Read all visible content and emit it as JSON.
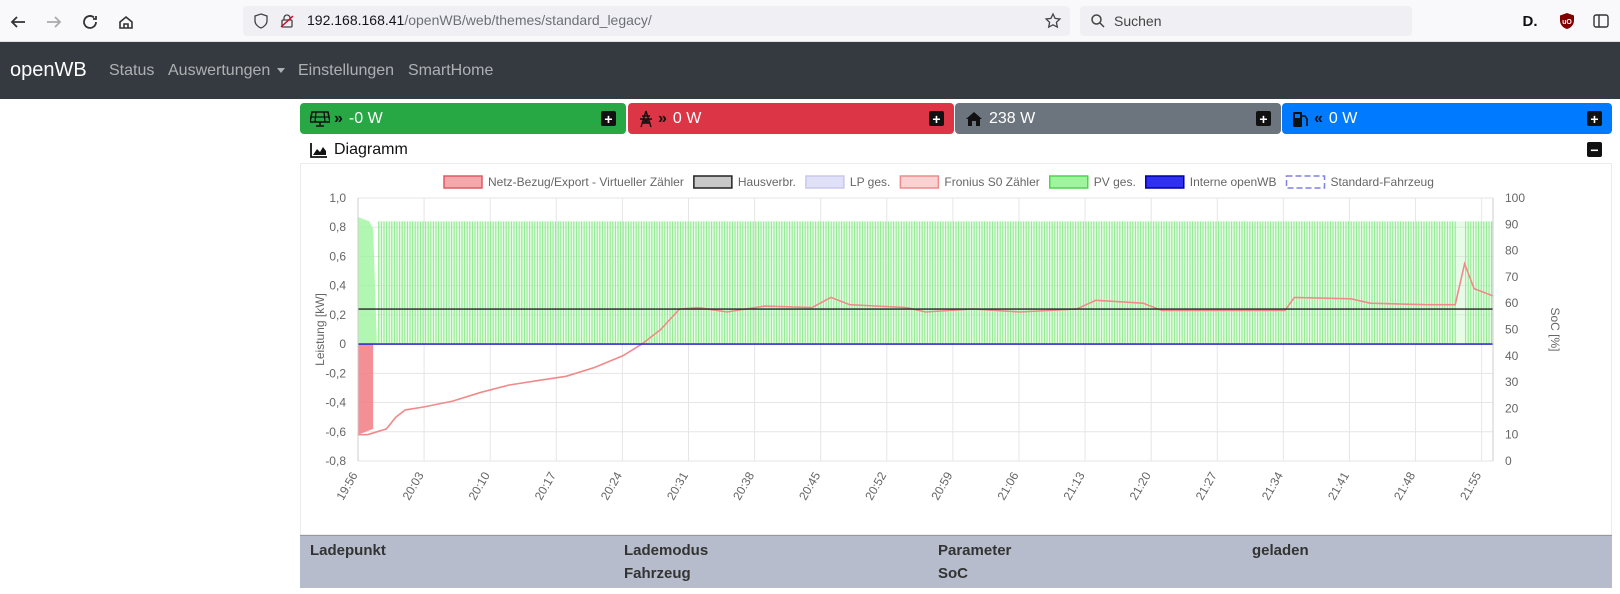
{
  "browser": {
    "url_host": "192.168.168.41",
    "url_path": "/openWB/web/themes/standard_legacy/",
    "search_placeholder": "Suchen"
  },
  "navbar": {
    "brand": "openWB",
    "items": [
      {
        "label": "Status"
      },
      {
        "label": "Auswertungen"
      },
      {
        "label": "Einstellungen"
      },
      {
        "label": "SmartHome"
      }
    ]
  },
  "tiles": {
    "pv": {
      "value": "-0 W",
      "color": "#28a745"
    },
    "grid": {
      "value": "0 W",
      "color": "#dc3545"
    },
    "house": {
      "value": "238 W",
      "color": "#6c757d"
    },
    "battery": {
      "value": "0 W",
      "color": "#007bff"
    }
  },
  "diagram": {
    "title": "Diagramm"
  },
  "chart_data": {
    "type": "line",
    "legend": [
      {
        "name": "Netz-Bezug/Export - Virtueller Zähler",
        "color": "#f4a8ac",
        "border": "#e05a63"
      },
      {
        "name": "Hausverbr.",
        "color": "#c8c8c8",
        "border": "#222222"
      },
      {
        "name": "LP ges.",
        "color": "#e0e0f7",
        "border": "#c8c8ee"
      },
      {
        "name": "Fronius S0 Zähler",
        "color": "#fbd2d2",
        "border": "#f08a8a"
      },
      {
        "name": "PV ges.",
        "color": "#9ef59e",
        "border": "#4cd64c"
      },
      {
        "name": "Interne openWB",
        "color": "#3030f0",
        "border": "#0000a0"
      },
      {
        "name": "Standard-Fahrzeug",
        "color": "#ffffff",
        "border": "#8080e0",
        "dashed": true
      }
    ],
    "legend_position": "top",
    "ylabel": "Leistung [kW]",
    "y2label": "SoC [%]",
    "ylim": [
      -0.8,
      1.0
    ],
    "y2lim": [
      0,
      100
    ],
    "yticks": [
      "1,0",
      "0,8",
      "0,6",
      "0,4",
      "0,2",
      "0",
      "-0,2",
      "-0,4",
      "-0,6",
      "-0,8"
    ],
    "y2ticks": [
      "100",
      "90",
      "80",
      "70",
      "60",
      "50",
      "40",
      "30",
      "20",
      "10",
      "0"
    ],
    "xticks": [
      "19:56",
      "20:03",
      "20:10",
      "20:17",
      "20:24",
      "20:31",
      "20:38",
      "20:45",
      "20:52",
      "20:59",
      "21:06",
      "21:13",
      "21:20",
      "21:27",
      "21:34",
      "21:41",
      "21:48",
      "21:55"
    ],
    "x_minutes_range": [
      0,
      120
    ],
    "hausverbr_kw": 0.24,
    "pv_peak_kw": 0.84,
    "grid_series": [
      {
        "t": 0,
        "kw": -0.62
      },
      {
        "t": 1,
        "kw": -0.62
      },
      {
        "t": 2,
        "kw": -0.6
      },
      {
        "t": 3,
        "kw": -0.58
      },
      {
        "t": 4,
        "kw": -0.5
      },
      {
        "t": 5,
        "kw": -0.45
      },
      {
        "t": 7,
        "kw": -0.43
      },
      {
        "t": 10,
        "kw": -0.39
      },
      {
        "t": 13,
        "kw": -0.33
      },
      {
        "t": 16,
        "kw": -0.28
      },
      {
        "t": 19,
        "kw": -0.25
      },
      {
        "t": 22,
        "kw": -0.22
      },
      {
        "t": 25,
        "kw": -0.16
      },
      {
        "t": 28,
        "kw": -0.08
      },
      {
        "t": 30,
        "kw": 0.0
      },
      {
        "t": 32,
        "kw": 0.1
      },
      {
        "t": 34,
        "kw": 0.24
      },
      {
        "t": 36,
        "kw": 0.25
      },
      {
        "t": 39,
        "kw": 0.22
      },
      {
        "t": 43,
        "kw": 0.26
      },
      {
        "t": 48,
        "kw": 0.25
      },
      {
        "t": 50,
        "kw": 0.32
      },
      {
        "t": 52,
        "kw": 0.27
      },
      {
        "t": 58,
        "kw": 0.25
      },
      {
        "t": 60,
        "kw": 0.22
      },
      {
        "t": 65,
        "kw": 0.24
      },
      {
        "t": 70,
        "kw": 0.22
      },
      {
        "t": 76,
        "kw": 0.24
      },
      {
        "t": 78,
        "kw": 0.3
      },
      {
        "t": 83,
        "kw": 0.28
      },
      {
        "t": 85,
        "kw": 0.23
      },
      {
        "t": 95,
        "kw": 0.23
      },
      {
        "t": 98,
        "kw": 0.23
      },
      {
        "t": 99,
        "kw": 0.32
      },
      {
        "t": 105,
        "kw": 0.31
      },
      {
        "t": 107,
        "kw": 0.28
      },
      {
        "t": 113,
        "kw": 0.27
      },
      {
        "t": 116,
        "kw": 0.27
      },
      {
        "t": 117,
        "kw": 0.55
      },
      {
        "t": 118,
        "kw": 0.38
      },
      {
        "t": 120,
        "kw": 0.33
      }
    ]
  },
  "table": {
    "headers": [
      {
        "line1": "Ladepunkt",
        "line2": ""
      },
      {
        "line1": "Lademodus",
        "line2": "Fahrzeug"
      },
      {
        "line1": "Parameter",
        "line2": "SoC"
      },
      {
        "line1": "geladen",
        "line2": ""
      }
    ]
  }
}
